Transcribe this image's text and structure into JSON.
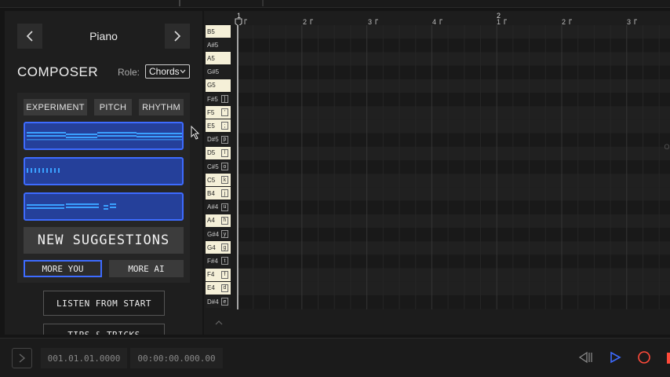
{
  "instrument": {
    "name": "Piano"
  },
  "composer": {
    "title": "COMPOSER",
    "role_label": "Role:",
    "role_value": "Chords",
    "tabs": [
      {
        "label": "EXPERIMENT"
      },
      {
        "label": "PITCH"
      },
      {
        "label": "RHYTHM"
      }
    ],
    "new_suggestions": "NEW SUGGESTIONS",
    "more_you": "MORE YOU",
    "more_ai": "MORE AI",
    "listen_from_start": "LISTEN FROM START",
    "tips": "TIPS & TRICKS"
  },
  "ruler": {
    "bars": [
      "1",
      "2"
    ],
    "beats": [
      "2",
      "3",
      "4",
      "1",
      "2",
      "3"
    ]
  },
  "keys": [
    {
      "note": "B5",
      "type": "white",
      "kb": ""
    },
    {
      "note": "A#5",
      "type": "black",
      "kb": ""
    },
    {
      "note": "A5",
      "type": "white",
      "kb": ""
    },
    {
      "note": "G#5",
      "type": "black",
      "kb": ""
    },
    {
      "note": "G5",
      "type": "white",
      "kb": ""
    },
    {
      "note": "F#5",
      "type": "black",
      "kb": "]"
    },
    {
      "note": "F5",
      "type": "white",
      "kb": "'"
    },
    {
      "note": "E5",
      "type": "white",
      "kb": ";"
    },
    {
      "note": "D#5",
      "type": "black",
      "kb": "p"
    },
    {
      "note": "D5",
      "type": "white",
      "kb": "l"
    },
    {
      "note": "C#5",
      "type": "black",
      "kb": "o"
    },
    {
      "note": "C5",
      "type": "white",
      "kb": "k"
    },
    {
      "note": "B4",
      "type": "white",
      "kb": "j"
    },
    {
      "note": "A#4",
      "type": "black",
      "kb": "u"
    },
    {
      "note": "A4",
      "type": "white",
      "kb": "h"
    },
    {
      "note": "G#4",
      "type": "black",
      "kb": "y"
    },
    {
      "note": "G4",
      "type": "white",
      "kb": "g"
    },
    {
      "note": "F#4",
      "type": "black",
      "kb": "t"
    },
    {
      "note": "F4",
      "type": "white",
      "kb": "f"
    },
    {
      "note": "E4",
      "type": "white",
      "kb": "d"
    },
    {
      "note": "D#4",
      "type": "black",
      "kb": "e"
    }
  ],
  "edge_label": "OR",
  "transport": {
    "bars_time": "001.01.01.0000",
    "clock_time": "00:00:00.000.00"
  },
  "colors": {
    "accent": "#3d6bff",
    "suggestion_fill": "#25409a",
    "note_blue": "#3aa0ff",
    "record": "#ff4a3a"
  },
  "icons": {
    "prev": "chevron-left-icon",
    "next": "chevron-right-icon",
    "dropdown": "chevron-down-icon",
    "play": "play-icon",
    "rewind": "rewind-icon",
    "record": "record-icon"
  }
}
